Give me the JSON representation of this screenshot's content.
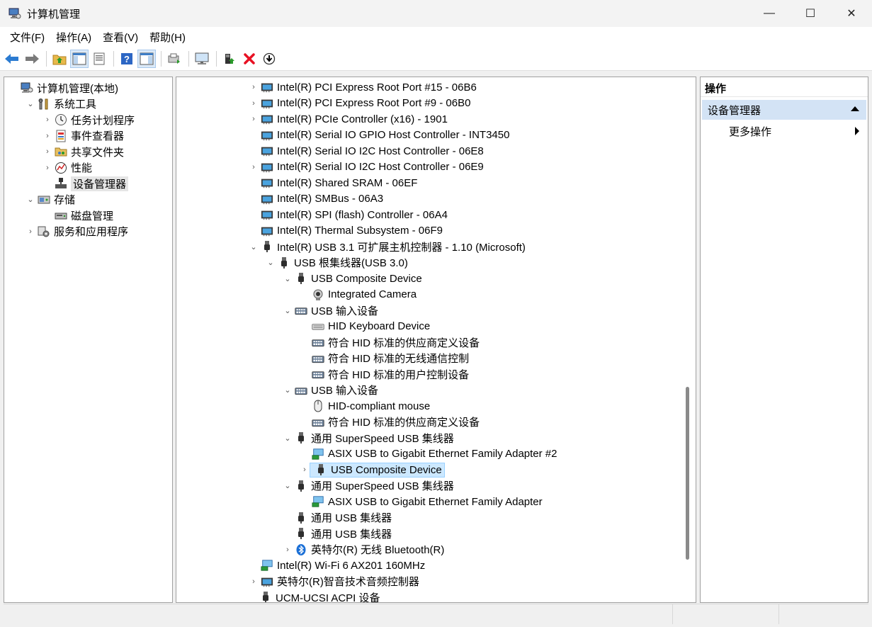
{
  "window": {
    "title": "计算机管理",
    "min": "—",
    "max": "☐",
    "close": "✕"
  },
  "menu": [
    "文件(F)",
    "操作(A)",
    "查看(V)",
    "帮助(H)"
  ],
  "toolbar": [
    "back-arrow",
    "forward-arrow",
    "up-folder",
    "show-hide-tree",
    "properties",
    "help",
    "show-action-pane",
    "export",
    "monitor",
    "add-driver",
    "remove",
    "download"
  ],
  "left_tree": [
    {
      "label": "计算机管理(本地)",
      "icon": "computer-mgmt-icon",
      "exp": "",
      "indent": 0
    },
    {
      "label": "系统工具",
      "icon": "tools-icon",
      "exp": "⌄",
      "indent": 1
    },
    {
      "label": "任务计划程序",
      "icon": "clock-icon",
      "exp": "›",
      "indent": 2
    },
    {
      "label": "事件查看器",
      "icon": "event-viewer-icon",
      "exp": "›",
      "indent": 2
    },
    {
      "label": "共享文件夹",
      "icon": "shared-folder-icon",
      "exp": "›",
      "indent": 2
    },
    {
      "label": "性能",
      "icon": "performance-icon",
      "exp": "›",
      "indent": 2
    },
    {
      "label": "设备管理器",
      "icon": "device-manager-icon",
      "exp": "",
      "indent": 2,
      "selected": true
    },
    {
      "label": "存储",
      "icon": "storage-icon",
      "exp": "⌄",
      "indent": 1
    },
    {
      "label": "磁盘管理",
      "icon": "disk-icon",
      "exp": "",
      "indent": 2
    },
    {
      "label": "服务和应用程序",
      "icon": "services-icon",
      "exp": "›",
      "indent": 1
    }
  ],
  "device_tree": [
    {
      "label": "Intel(R) PCI Express Root Port #15 - 06B6",
      "icon": "pci-device-icon",
      "exp": "›",
      "level": 0
    },
    {
      "label": "Intel(R) PCI Express Root Port #9 - 06B0",
      "icon": "pci-device-icon",
      "exp": "›",
      "level": 0
    },
    {
      "label": "Intel(R) PCIe Controller (x16) - 1901",
      "icon": "pci-device-icon",
      "exp": "›",
      "level": 0
    },
    {
      "label": "Intel(R) Serial IO GPIO Host Controller - INT3450",
      "icon": "pci-device-icon",
      "exp": "",
      "level": 0
    },
    {
      "label": "Intel(R) Serial IO I2C Host Controller - 06E8",
      "icon": "pci-device-icon",
      "exp": "",
      "level": 0
    },
    {
      "label": "Intel(R) Serial IO I2C Host Controller - 06E9",
      "icon": "pci-device-icon",
      "exp": "›",
      "level": 0
    },
    {
      "label": "Intel(R) Shared SRAM - 06EF",
      "icon": "pci-device-icon",
      "exp": "",
      "level": 0
    },
    {
      "label": "Intel(R) SMBus - 06A3",
      "icon": "pci-device-icon",
      "exp": "",
      "level": 0
    },
    {
      "label": "Intel(R) SPI (flash) Controller - 06A4",
      "icon": "pci-device-icon",
      "exp": "",
      "level": 0
    },
    {
      "label": "Intel(R) Thermal Subsystem - 06F9",
      "icon": "pci-device-icon",
      "exp": "",
      "level": 0
    },
    {
      "label": "Intel(R) USB 3.1 可扩展主机控制器 - 1.10 (Microsoft)",
      "icon": "usb-icon",
      "exp": "⌄",
      "level": 0
    },
    {
      "label": "USB 根集线器(USB 3.0)",
      "icon": "usb-icon",
      "exp": "⌄",
      "level": 1
    },
    {
      "label": "USB Composite Device",
      "icon": "usb-icon",
      "exp": "⌄",
      "level": 2
    },
    {
      "label": "Integrated Camera",
      "icon": "camera-icon",
      "exp": "",
      "level": 3
    },
    {
      "label": "USB 输入设备",
      "icon": "hid-icon",
      "exp": "⌄",
      "level": 2
    },
    {
      "label": "HID Keyboard Device",
      "icon": "keyboard-icon",
      "exp": "",
      "level": 3
    },
    {
      "label": "符合 HID 标准的供应商定义设备",
      "icon": "hid-icon",
      "exp": "",
      "level": 3
    },
    {
      "label": "符合 HID 标准的无线通信控制",
      "icon": "hid-icon",
      "exp": "",
      "level": 3
    },
    {
      "label": "符合 HID 标准的用户控制设备",
      "icon": "hid-icon",
      "exp": "",
      "level": 3
    },
    {
      "label": "USB 输入设备",
      "icon": "hid-icon",
      "exp": "⌄",
      "level": 2
    },
    {
      "label": "HID-compliant mouse",
      "icon": "mouse-icon",
      "exp": "",
      "level": 3
    },
    {
      "label": "符合 HID 标准的供应商定义设备",
      "icon": "hid-icon",
      "exp": "",
      "level": 3
    },
    {
      "label": "通用 SuperSpeed USB 集线器",
      "icon": "usb-icon",
      "exp": "⌄",
      "level": 2
    },
    {
      "label": "ASIX USB to Gigabit Ethernet Family Adapter #2",
      "icon": "network-icon",
      "exp": "",
      "level": 3
    },
    {
      "label": "USB Composite Device",
      "icon": "usb-icon",
      "exp": "›",
      "level": 3,
      "selected": true
    },
    {
      "label": "通用 SuperSpeed USB 集线器",
      "icon": "usb-icon",
      "exp": "⌄",
      "level": 2
    },
    {
      "label": "ASIX USB to Gigabit Ethernet Family Adapter",
      "icon": "network-icon",
      "exp": "",
      "level": 3
    },
    {
      "label": "通用 USB 集线器",
      "icon": "usb-icon",
      "exp": "",
      "level": 2
    },
    {
      "label": "通用 USB 集线器",
      "icon": "usb-icon",
      "exp": "",
      "level": 2
    },
    {
      "label": "英特尔(R) 无线 Bluetooth(R)",
      "icon": "bluetooth-icon",
      "exp": "›",
      "level": 2
    },
    {
      "label": "Intel(R) Wi-Fi 6 AX201 160MHz",
      "icon": "network-icon",
      "exp": "",
      "level": 0
    },
    {
      "label": "英特尔(R)智音技术音频控制器",
      "icon": "pci-device-icon",
      "exp": "›",
      "level": 0
    },
    {
      "label": "UCM-UCSI ACPI 设备",
      "icon": "usb-icon",
      "exp": "",
      "level": -1
    }
  ],
  "actions": {
    "header": "操作",
    "section": "设备管理器",
    "more": "更多操作"
  },
  "colors": {
    "selection_blue": "#cce8ff",
    "actions_section": "#d3e3f5",
    "remove_red": "#e81123",
    "icon_blue": "#1e78c8"
  }
}
